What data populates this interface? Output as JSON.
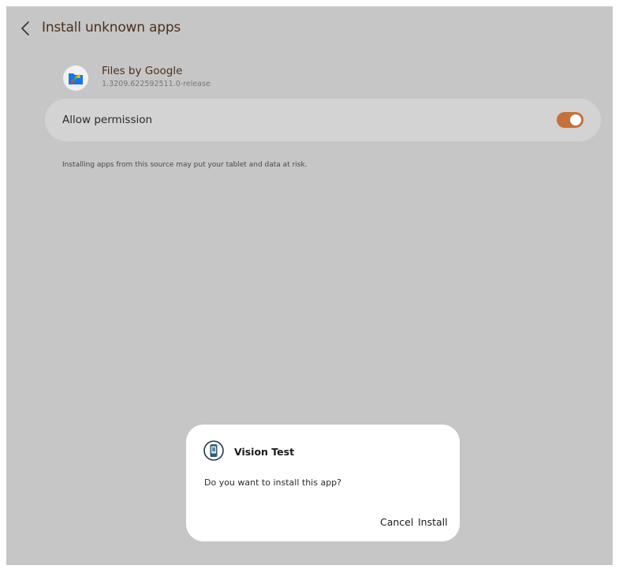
{
  "header": {
    "title": "Install unknown apps"
  },
  "app": {
    "name": "Files by Google",
    "version": "1.3209.622592511.0-release",
    "icon": "files-by-google-icon"
  },
  "permission": {
    "label": "Allow permission",
    "enabled": true,
    "toggle_color": "#c4723a"
  },
  "warning": "Installing apps from this source may put your tablet and data at risk.",
  "dialog": {
    "app_name": "Vision Test",
    "icon": "phone-app-icon",
    "message": "Do you want to install this app?",
    "cancel_label": "Cancel",
    "install_label": "Install"
  }
}
